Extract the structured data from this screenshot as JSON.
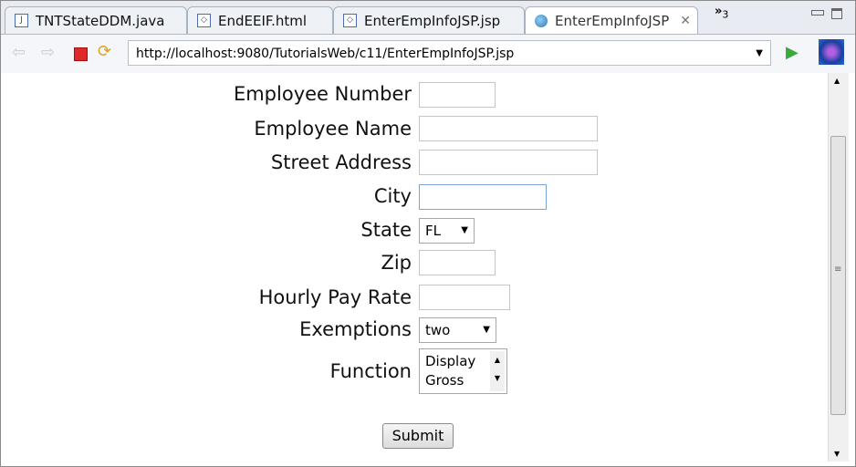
{
  "tabs": [
    {
      "label": "TNTStateDDM.java",
      "icon": "java-file-icon"
    },
    {
      "label": "EndEEIF.html",
      "icon": "html-file-icon"
    },
    {
      "label": "EnterEmpInfoJSP.jsp",
      "icon": "html-file-icon"
    },
    {
      "label": "EnterEmpInfoJSP",
      "icon": "globe-icon",
      "active": true
    }
  ],
  "overflow": {
    "chevron": "»",
    "count": "3"
  },
  "url": "http://localhost:9080/TutorialsWeb/c11/EnterEmpInfoJSP.jsp",
  "form": {
    "employee_number": "Employee Number",
    "employee_name": "Employee Name",
    "street_address": "Street Address",
    "city": "City",
    "state": "State",
    "state_value": "FL",
    "zip": "Zip",
    "hourly_pay_rate": "Hourly Pay Rate",
    "exemptions": "Exemptions",
    "exemptions_value": "two",
    "function": "Function",
    "function_options": [
      "Display",
      "Gross"
    ],
    "submit": "Submit"
  },
  "colors": {
    "focus": "#7ea6d8",
    "stop": "#e02a2a",
    "go": "#3aa83a"
  }
}
